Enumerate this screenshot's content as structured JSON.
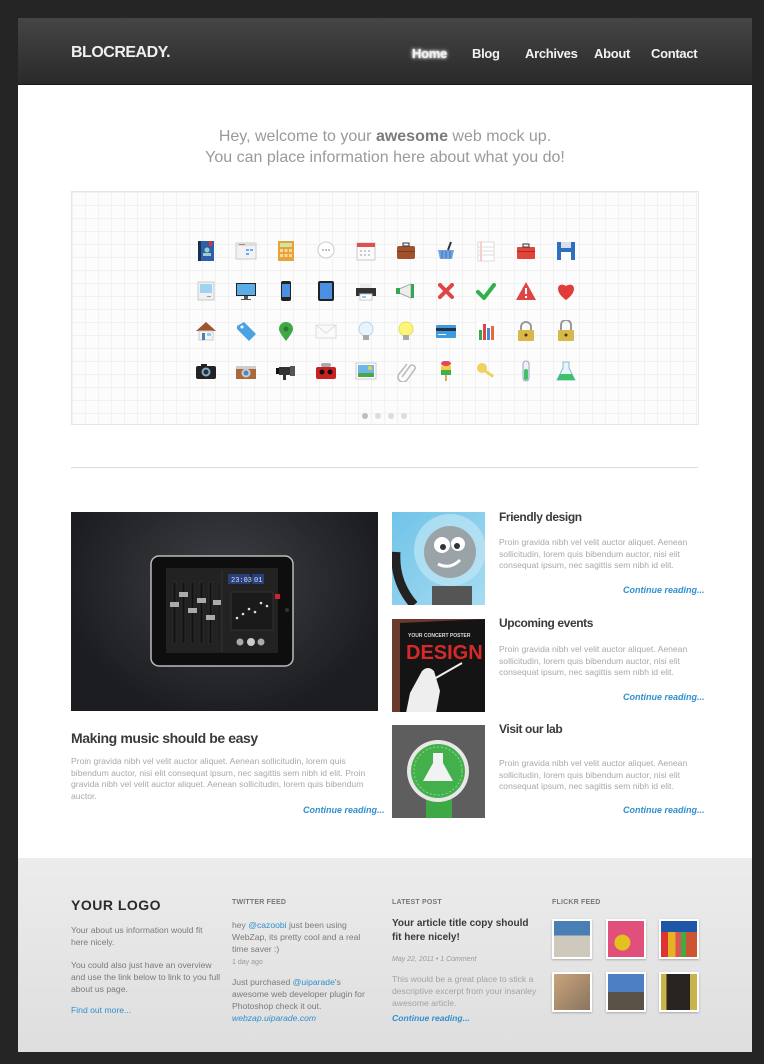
{
  "header": {
    "logo": "BLOCREADY.",
    "nav": [
      "Home",
      "Blog",
      "Archives",
      "About",
      "Contact"
    ],
    "active_nav": "Home"
  },
  "hero": {
    "line1_pre": "Hey, welcome to your ",
    "line1_bold": "awesome",
    "line1_post": " web mock up.",
    "line2": "You can place information here about what you do!"
  },
  "icon_grid": {
    "rows": [
      [
        "address-book-icon",
        "browser-window-icon",
        "calculator-icon",
        "chat-bubble-icon",
        "calendar-icon",
        "briefcase-icon",
        "shopping-basket-icon",
        "notepad-icon",
        "toolbox-icon",
        "floppy-disk-icon"
      ],
      [
        "classic-mac-icon",
        "monitor-icon",
        "phone-icon",
        "tablet-icon",
        "printer-icon",
        "megaphone-icon",
        "cross-icon",
        "checkmark-icon",
        "warning-icon",
        "heart-icon"
      ],
      [
        "home-icon",
        "tag-icon",
        "map-pin-icon",
        "envelope-icon",
        "lightbulb-off-icon",
        "lightbulb-on-icon",
        "credit-card-icon",
        "bar-chart-icon",
        "lock-closed-icon",
        "lock-open-icon"
      ],
      [
        "camera-icon",
        "vintage-camera-icon",
        "video-camera-icon",
        "viewmaster-icon",
        "picture-icon",
        "paperclip-icon",
        "popsicle-icon",
        "key-icon",
        "test-tube-icon",
        "flask-icon"
      ]
    ],
    "pagination_count": 4,
    "pagination_active": 1
  },
  "feature": {
    "title": "Making music should be easy",
    "body": "Proin gravida nibh vel velit auctor aliquet. Aenean sollicitudin, lorem quis bibendum auctor, nisi elit consequat ipsum, nec sagittis sem nibh id elit. Proin gravida nibh vel velit auctor aliquet. Aenean sollicitudin, lorem quis bibendum auctor.",
    "link": "Continue reading...",
    "image": {
      "display_time": "23:03",
      "display_track": "01"
    }
  },
  "articles": [
    {
      "title": "Friendly design",
      "body": "Proin gravida nibh vel velit auctor aliquet. Aenean sollicitudin, lorem quis bibendum auctor, nisi elit consequat ipsum, nec sagittis sem nibh id elit.",
      "link": "Continue reading..."
    },
    {
      "title": "Upcoming events",
      "body": "Proin gravida nibh vel velit auctor aliquet. Aenean sollicitudin, lorem quis bibendum auctor, nisi elit consequat ipsum, nec sagittis sem nibh id elit.",
      "link": "Continue reading...",
      "poster_text": "DESIGN"
    },
    {
      "title": "Visit our lab",
      "body": "Proin gravida nibh vel velit auctor aliquet. Aenean sollicitudin, lorem quis bibendum auctor, nisi elit consequat ipsum, nec sagittis sem nibh id elit.",
      "link": "Continue reading..."
    }
  ],
  "footer": {
    "logo": "YOUR LOGO",
    "about1": "Your about us information would fit here nicely.",
    "about2": "You could also just have an overview and use the link below to link to you full about us page.",
    "about_link": "Find out more...",
    "twitter": {
      "label": "TWITTER FEED",
      "tweet1_pre": "hey ",
      "tweet1_handle": "@cazoobi",
      "tweet1_post": " just been using WebZap, its pretty cool and a real time saver :)",
      "tweet1_time": "1 day ago",
      "tweet2_pre": "Just purchased ",
      "tweet2_handle": "@uiparade",
      "tweet2_post": "'s awesome web developer plugin for Photoshop check it out.",
      "tweet2_link": "webzap.uiparade.com"
    },
    "latest": {
      "label": "LATEST POST",
      "title": "Your article title copy should fit here nicely!",
      "meta": "May 22, 2011 • 1 Comment",
      "excerpt": "This would be a great place to stick a descriptive excerpt from your insanley awesome article.",
      "link": "Continue reading..."
    },
    "flickr": {
      "label": "FLICKR FEED",
      "photos": [
        "building-photo",
        "flower-photo",
        "beach-huts-photo",
        "rope-photo",
        "bridge-photo",
        "yellow-wall-photo"
      ]
    }
  }
}
